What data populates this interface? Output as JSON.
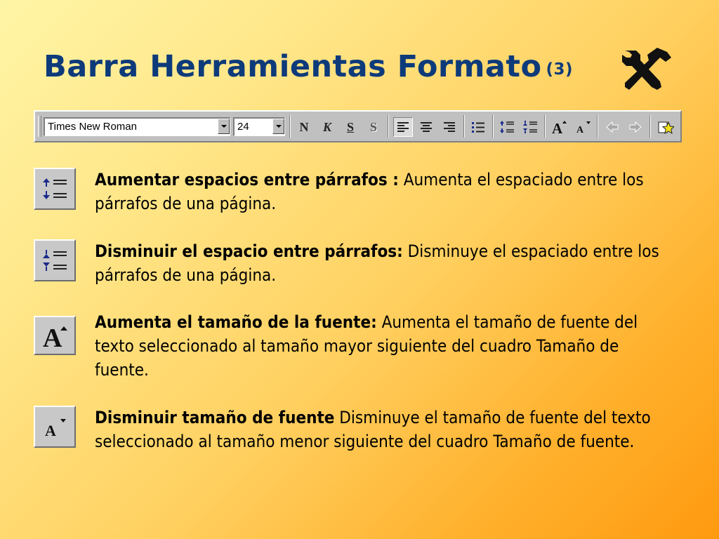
{
  "slide": {
    "title": "Barra Herramientas Formato",
    "title_suffix": "(3)"
  },
  "toolbar": {
    "font_name": "Times New Roman",
    "font_size": "24",
    "bold_glyph": "N",
    "italic_glyph": "K",
    "underline_glyph": "S",
    "shadow_glyph": "S"
  },
  "items": [
    {
      "term": "Aumentar espacios entre párrafos :",
      "description": " Aumenta el espaciado entre los párrafos de una página.",
      "icon": "increase-paragraph-spacing-icon"
    },
    {
      "term": "Disminuir el espacio entre párrafos:",
      "description": " Disminuye el espaciado entre los párrafos de una página.",
      "icon": "decrease-paragraph-spacing-icon"
    },
    {
      "term": "Aumenta el tamaño de la fuente:",
      "description": " Aumenta el tamaño de fuente del texto seleccionado al tamaño mayor siguiente del cuadro Tamaño de fuente.",
      "icon": "increase-font-size-icon"
    },
    {
      "term": "Disminuir tamaño de fuente",
      "description": " Disminuye el tamaño de fuente del texto seleccionado al tamaño menor siguiente del cuadro Tamaño de fuente.",
      "icon": "decrease-font-size-icon"
    }
  ],
  "colors": {
    "title": "#0d3a7a",
    "background_start": "#fff5a6",
    "background_end": "#ff9a10",
    "toolbar": "#c0c0c0",
    "icon_blue": "#1a2a8a"
  }
}
